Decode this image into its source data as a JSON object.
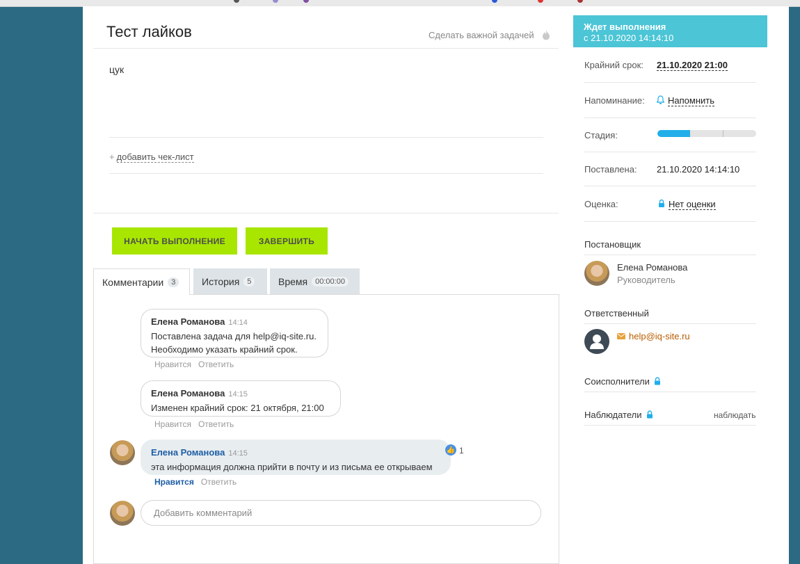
{
  "task": {
    "title": "Тест лайков",
    "make_important": "Сделать важной задачей",
    "description": "цук",
    "add_checklist": "добавить чек-лист"
  },
  "buttons": {
    "start": "НАЧАТЬ ВЫПОЛНЕНИЕ",
    "finish": "ЗАВЕРШИТЬ"
  },
  "tabs": [
    {
      "label": "Комментарии",
      "count": "3"
    },
    {
      "label": "История",
      "count": "5"
    },
    {
      "label": "Время",
      "count": "00:00:00"
    }
  ],
  "comments": [
    {
      "author": "Елена Романова",
      "time": "14:14",
      "lines": [
        "Поставлена задача для help@iq-site.ru.",
        "Необходимо указать крайний срок."
      ],
      "like": "Нравится",
      "reply": "Ответить"
    },
    {
      "author": "Елена Романова",
      "time": "14:15",
      "lines": [
        "Изменен крайний срок: 21 октября, 21:00"
      ],
      "like": "Нравится",
      "reply": "Ответить"
    },
    {
      "author": "Елена Романова",
      "time": "14:15",
      "lines": [
        "эта информация должна прийти в почту  и из письма ее открываем"
      ],
      "like": "Нравится",
      "reply": "Ответить",
      "likes": "1"
    }
  ],
  "add_comment_placeholder": "Добавить комментарий",
  "sidebar": {
    "status_title": "Ждет выполнения",
    "status_since": "с 21.10.2020 14:14:10",
    "deadline_label": "Крайний срок:",
    "deadline_value": "21.10.2020 21:00",
    "reminder_label": "Напоминание:",
    "reminder_value": "Напомнить",
    "stage_label": "Стадия:",
    "stage_progress": 0.33,
    "created_label": "Поставлена:",
    "created_value": "21.10.2020 14:14:10",
    "rating_label": "Оценка:",
    "rating_value": "Нет оценки",
    "creator_title": "Постановщик",
    "creator_name": "Елена Романова",
    "creator_role": "Руководитель",
    "responsible_title": "Ответственный",
    "responsible_email": "help@iq-site.ru",
    "coexecutors_title": "Соисполнители",
    "observers_title": "Наблюдатели",
    "watch_link": "наблюдать"
  },
  "colors": {
    "background": "#2b6a82",
    "accent_green": "#a8e600",
    "status_cyan": "#4cc5d6",
    "link_blue": "#1d5ea5",
    "stage_blue": "#21aee9"
  }
}
